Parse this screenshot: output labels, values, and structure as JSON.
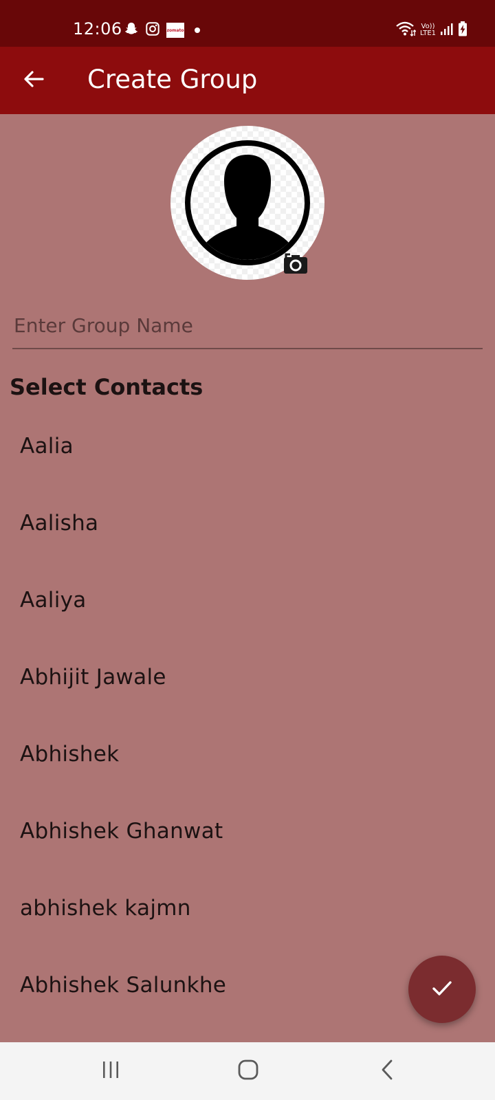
{
  "status_bar": {
    "time": "12:06",
    "left_icons": [
      "snapchat-icon",
      "instagram-icon",
      "zomato-icon",
      "notification-dot-icon"
    ],
    "zomato_text": "zomato",
    "right_icons": [
      "wifi-icon",
      "volte-icon",
      "signal-icon",
      "battery-charging-icon"
    ],
    "volte_text_top": "Vo))",
    "volte_text_bottom": "LTE1"
  },
  "app_bar": {
    "title": "Create Group",
    "back_icon": "arrow-back-icon"
  },
  "avatar": {
    "icon": "person-silhouette-icon",
    "camera_icon": "camera-icon"
  },
  "group_name": {
    "placeholder": "Enter Group Name",
    "value": ""
  },
  "contacts": {
    "title": "Select Contacts",
    "items": [
      "Aalia",
      "Aalisha",
      "Aaliya",
      "Abhijit Jawale",
      "Abhishek",
      "Abhishek Ghanwat",
      "abhishek kajmn",
      "Abhishek Salunkhe"
    ]
  },
  "fab": {
    "icon": "check-icon"
  },
  "nav": {
    "items": [
      "recent-apps-icon",
      "home-icon",
      "back-icon"
    ]
  },
  "colors": {
    "status_bar": "#680708",
    "app_bar": "#8d0c0d",
    "background": "#ad7574",
    "fab": "#7b2c2f",
    "nav_bar": "#f4f4f4"
  }
}
